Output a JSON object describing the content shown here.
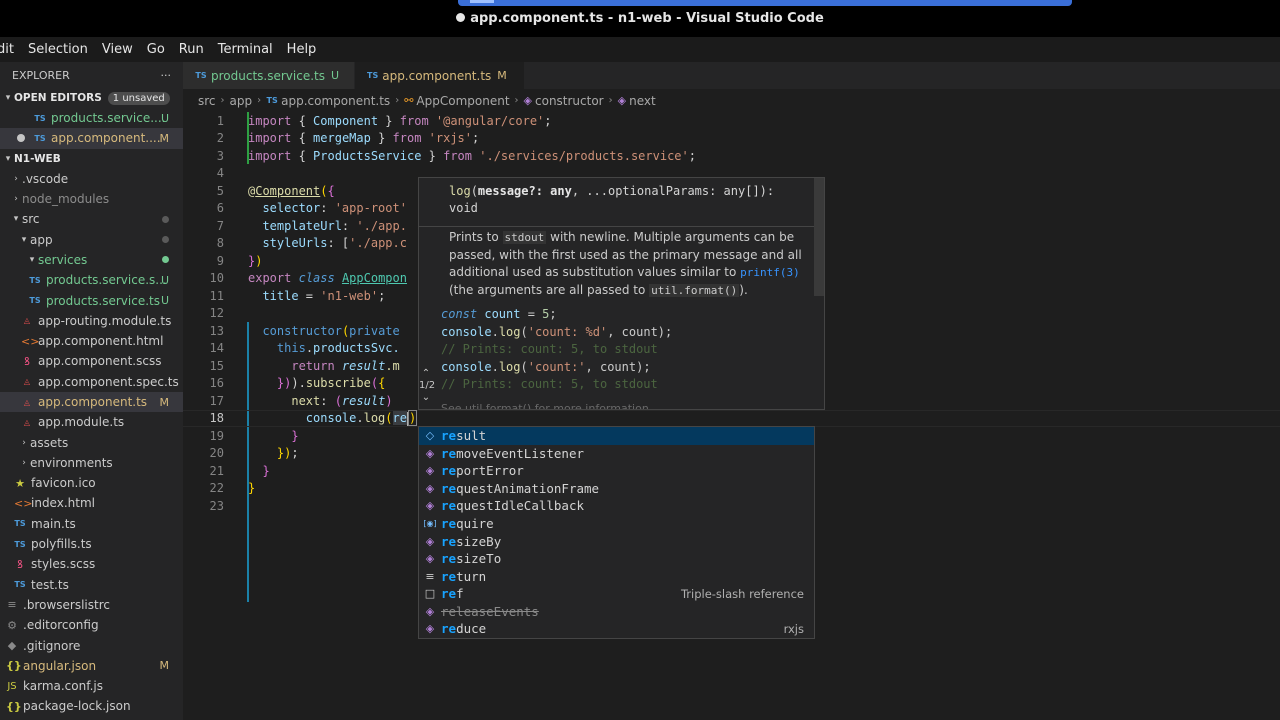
{
  "window": {
    "title": "app.component.ts - n1-web - Visual Studio Code"
  },
  "menu": [
    "dit",
    "Selection",
    "View",
    "Go",
    "Run",
    "Terminal",
    "Help"
  ],
  "explorer": {
    "title": "EXPLORER",
    "more": "···",
    "open_editors": {
      "title": "OPEN EDITORS",
      "badge": "1 unsaved",
      "items": [
        {
          "name": "products.service....",
          "status": "U"
        },
        {
          "name": "app.component....",
          "status": "M"
        }
      ]
    },
    "project": {
      "title": "N1-WEB",
      "tree": [
        {
          "name": ".vscode"
        },
        {
          "name": "node_modules"
        },
        {
          "name": "src"
        },
        {
          "name": "app"
        },
        {
          "name": "services"
        },
        {
          "name": "products.service.s...",
          "status": "U"
        },
        {
          "name": "products.service.ts",
          "status": "U"
        },
        {
          "name": "app-routing.module.ts"
        },
        {
          "name": "app.component.html"
        },
        {
          "name": "app.component.scss"
        },
        {
          "name": "app.component.spec.ts"
        },
        {
          "name": "app.component.ts",
          "status": "M"
        },
        {
          "name": "app.module.ts"
        },
        {
          "name": "assets"
        },
        {
          "name": "environments"
        },
        {
          "name": "favicon.ico"
        },
        {
          "name": "index.html"
        },
        {
          "name": "main.ts"
        },
        {
          "name": "polyfills.ts"
        },
        {
          "name": "styles.scss"
        },
        {
          "name": "test.ts"
        },
        {
          "name": ".browserslistrc"
        },
        {
          "name": ".editorconfig"
        },
        {
          "name": ".gitignore"
        },
        {
          "name": "angular.json",
          "status": "M"
        },
        {
          "name": "karma.conf.js"
        },
        {
          "name": "package-lock.json"
        }
      ]
    }
  },
  "tabs": [
    {
      "icon": "TS",
      "label": "products.service.ts",
      "status": "U"
    },
    {
      "icon": "TS",
      "label": "app.component.ts",
      "status": "M"
    }
  ],
  "breadcrumb": [
    "src",
    "app",
    "app.component.ts",
    "AppComponent",
    "constructor",
    "next"
  ],
  "editor": {
    "line_numbers": [
      "1",
      "2",
      "3",
      "4",
      "5",
      "6",
      "7",
      "8",
      "9",
      "10",
      "11",
      "12",
      "13",
      "14",
      "15",
      "16",
      "17",
      "18",
      "19",
      "20",
      "21",
      "22",
      "23"
    ],
    "lines": {
      "l1": [
        "import",
        " { ",
        "Component",
        " } ",
        "from",
        " '@angular/core'",
        ";"
      ],
      "l2": [
        "import",
        " { ",
        "mergeMap",
        " } ",
        "from",
        " 'rxjs'",
        ";"
      ],
      "l3": [
        "import",
        " { ",
        "ProductsService",
        " } ",
        "from",
        " './services/products.service'",
        ";"
      ],
      "l5": [
        "@",
        "Component",
        "(",
        "{"
      ],
      "l6": [
        "  selector",
        ": ",
        "'app-root'"
      ],
      "l7": [
        "  templateUrl",
        ": ",
        "'./app."
      ],
      "l8": [
        "  styleUrls",
        ": [",
        "'./app.c"
      ],
      "l9": [
        "}",
        ")"
      ],
      "l10": [
        "export",
        " ",
        "class",
        " ",
        "AppCompon"
      ],
      "l11": [
        "  title",
        " = ",
        "'n1-web'",
        ";"
      ],
      "l13": [
        "  ",
        "constructor",
        "(",
        "private"
      ],
      "l14": [
        "    ",
        "this",
        ".",
        "productsSvc."
      ],
      "l15": [
        "      ",
        "return",
        " ",
        "result",
        ".m"
      ],
      "l16": [
        "    ",
        "})",
        ").",
        "subscribe",
        "(",
        "{"
      ],
      "l17": [
        "      ",
        "next",
        ": ",
        "(",
        "result",
        ")"
      ],
      "l18": [
        "        ",
        "console",
        ".",
        "log",
        "(",
        "re",
        ")"
      ],
      "l19": [
        "      ",
        "}"
      ],
      "l20": [
        "    ",
        "})",
        ";"
      ],
      "l21": [
        "  ",
        "}"
      ],
      "l22": [
        "}"
      ]
    }
  },
  "hover": {
    "signature": [
      "log",
      "(",
      "message?: any",
      ", ...optionalParams: any[]):",
      "void"
    ],
    "doc": {
      "p1": "Prints to",
      "c1": "stdout",
      "p2": "with newline. Multiple arguments can be passed, with the first used as the primary message and all additional used as substitution values similar to",
      "link": "printf(3)",
      "p3": "(the arguments are all passed to",
      "c2": "util.format()",
      "p4": ")."
    },
    "example": [
      [
        "const",
        " count ",
        "= ",
        "5",
        ";"
      ],
      [
        "console",
        ".",
        "log",
        "(",
        "'count: %d'",
        ", count);"
      ],
      [
        "// Prints: count: 5, to stdout"
      ],
      [
        "console",
        ".",
        "log",
        "(",
        "'count:'",
        ", count);"
      ],
      [
        "// Prints: count: 5, to stdout"
      ]
    ],
    "see": "See util.format() for more information.",
    "counter": [
      "⌃",
      "1/2",
      "⌄"
    ]
  },
  "suggest": {
    "items": [
      {
        "icon": "◇",
        "hl": "re",
        "rest": "sult",
        "detail": ""
      },
      {
        "icon": "◈",
        "hl": "re",
        "rest": "moveEventListener",
        "detail": ""
      },
      {
        "icon": "◈",
        "hl": "re",
        "rest": "portError",
        "detail": ""
      },
      {
        "icon": "◈",
        "hl": "re",
        "rest": "questAnimationFrame",
        "detail": ""
      },
      {
        "icon": "◈",
        "hl": "re",
        "rest": "questIdleCallback",
        "detail": ""
      },
      {
        "icon": "[◉]",
        "hl": "re",
        "rest": "quire",
        "detail": ""
      },
      {
        "icon": "◈",
        "hl": "re",
        "rest": "sizeBy",
        "detail": ""
      },
      {
        "icon": "◈",
        "hl": "re",
        "rest": "sizeTo",
        "detail": ""
      },
      {
        "icon": "≡",
        "hl": "re",
        "rest": "turn",
        "detail": ""
      },
      {
        "icon": "□",
        "hl": "re",
        "rest": "f",
        "detail": "Triple-slash reference"
      },
      {
        "icon": "◈",
        "hl": "",
        "rest": "releaseEvents",
        "detail": ""
      },
      {
        "icon": "◈",
        "hl": "re",
        "rest": "duce",
        "detail": "rxjs"
      }
    ]
  },
  "colors": {
    "accent": "#007acc",
    "modified": "#d7ba7d",
    "untracked": "#73c991"
  }
}
